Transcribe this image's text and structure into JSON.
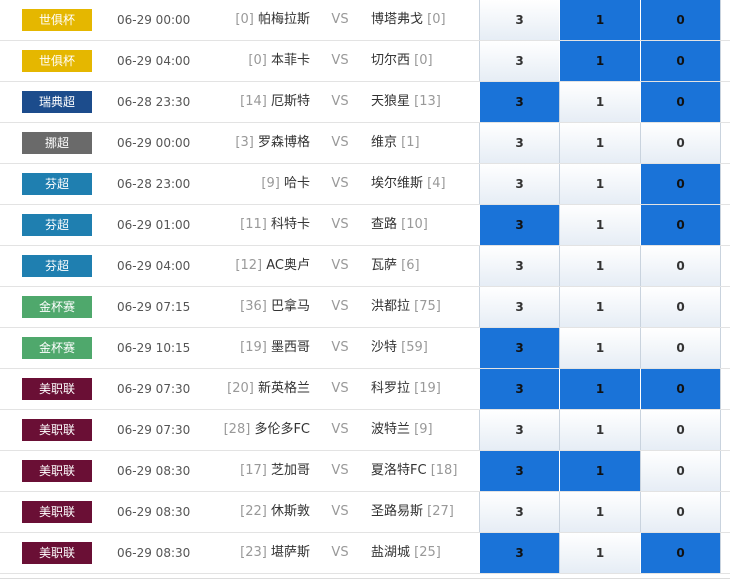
{
  "option_labels": [
    "3",
    "1",
    "0"
  ],
  "colors": {
    "selected": "#1a73d8",
    "unselected_top": "#ffffff",
    "unselected_bottom": "#e6edf5"
  },
  "matches": [
    {
      "league": "世俱杯",
      "league_color": "#e5b700",
      "time": "06-29 00:00",
      "home_rank": "[0]",
      "home": "帕梅拉斯",
      "vs": "VS",
      "away": "博塔弗戈",
      "away_rank": "[0]",
      "selected": [
        false,
        true,
        true
      ]
    },
    {
      "league": "世俱杯",
      "league_color": "#e5b700",
      "time": "06-29 04:00",
      "home_rank": "[0]",
      "home": "本菲卡",
      "vs": "VS",
      "away": "切尔西",
      "away_rank": "[0]",
      "selected": [
        false,
        true,
        true
      ]
    },
    {
      "league": "瑞典超",
      "league_color": "#1c4c8c",
      "time": "06-28 23:30",
      "home_rank": "[14]",
      "home": "厄斯特",
      "vs": "VS",
      "away": "天狼星",
      "away_rank": "[13]",
      "selected": [
        true,
        false,
        true
      ]
    },
    {
      "league": "挪超",
      "league_color": "#6a6a6a",
      "time": "06-29 00:00",
      "home_rank": "[3]",
      "home": "罗森博格",
      "vs": "VS",
      "away": "维京",
      "away_rank": "[1]",
      "selected": [
        false,
        false,
        false
      ]
    },
    {
      "league": "芬超",
      "league_color": "#1f7fb0",
      "time": "06-28 23:00",
      "home_rank": "[9]",
      "home": "哈卡",
      "vs": "VS",
      "away": "埃尔维斯",
      "away_rank": "[4]",
      "selected": [
        false,
        false,
        true
      ]
    },
    {
      "league": "芬超",
      "league_color": "#1f7fb0",
      "time": "06-29 01:00",
      "home_rank": "[11]",
      "home": "科特卡",
      "vs": "VS",
      "away": "查路",
      "away_rank": "[10]",
      "selected": [
        true,
        false,
        true
      ]
    },
    {
      "league": "芬超",
      "league_color": "#1f7fb0",
      "time": "06-29 04:00",
      "home_rank": "[12]",
      "home": "AC奥卢",
      "vs": "VS",
      "away": "瓦萨",
      "away_rank": "[6]",
      "selected": [
        false,
        false,
        false
      ]
    },
    {
      "league": "金杯赛",
      "league_color": "#4fa86c",
      "time": "06-29 07:15",
      "home_rank": "[36]",
      "home": "巴拿马",
      "vs": "VS",
      "away": "洪都拉",
      "away_rank": "[75]",
      "selected": [
        false,
        false,
        false
      ]
    },
    {
      "league": "金杯赛",
      "league_color": "#4fa86c",
      "time": "06-29 10:15",
      "home_rank": "[19]",
      "home": "墨西哥",
      "vs": "VS",
      "away": "沙特",
      "away_rank": "[59]",
      "selected": [
        true,
        false,
        false
      ]
    },
    {
      "league": "美职联",
      "league_color": "#6a0f35",
      "time": "06-29 07:30",
      "home_rank": "[20]",
      "home": "新英格兰",
      "vs": "VS",
      "away": "科罗拉",
      "away_rank": "[19]",
      "selected": [
        true,
        true,
        true
      ]
    },
    {
      "league": "美职联",
      "league_color": "#6a0f35",
      "time": "06-29 07:30",
      "home_rank": "[28]",
      "home": "多伦多FC",
      "vs": "VS",
      "away": "波特兰",
      "away_rank": "[9]",
      "selected": [
        false,
        false,
        false
      ]
    },
    {
      "league": "美职联",
      "league_color": "#6a0f35",
      "time": "06-29 08:30",
      "home_rank": "[17]",
      "home": "芝加哥",
      "vs": "VS",
      "away": "夏洛特FC",
      "away_rank": "[18]",
      "selected": [
        true,
        true,
        false
      ]
    },
    {
      "league": "美职联",
      "league_color": "#6a0f35",
      "time": "06-29 08:30",
      "home_rank": "[22]",
      "home": "休斯敦",
      "vs": "VS",
      "away": "圣路易斯",
      "away_rank": "[27]",
      "selected": [
        false,
        false,
        false
      ]
    },
    {
      "league": "美职联",
      "league_color": "#6a0f35",
      "time": "06-29 08:30",
      "home_rank": "[23]",
      "home": "堪萨斯",
      "vs": "VS",
      "away": "盐湖城",
      "away_rank": "[25]",
      "selected": [
        true,
        false,
        true
      ]
    }
  ]
}
